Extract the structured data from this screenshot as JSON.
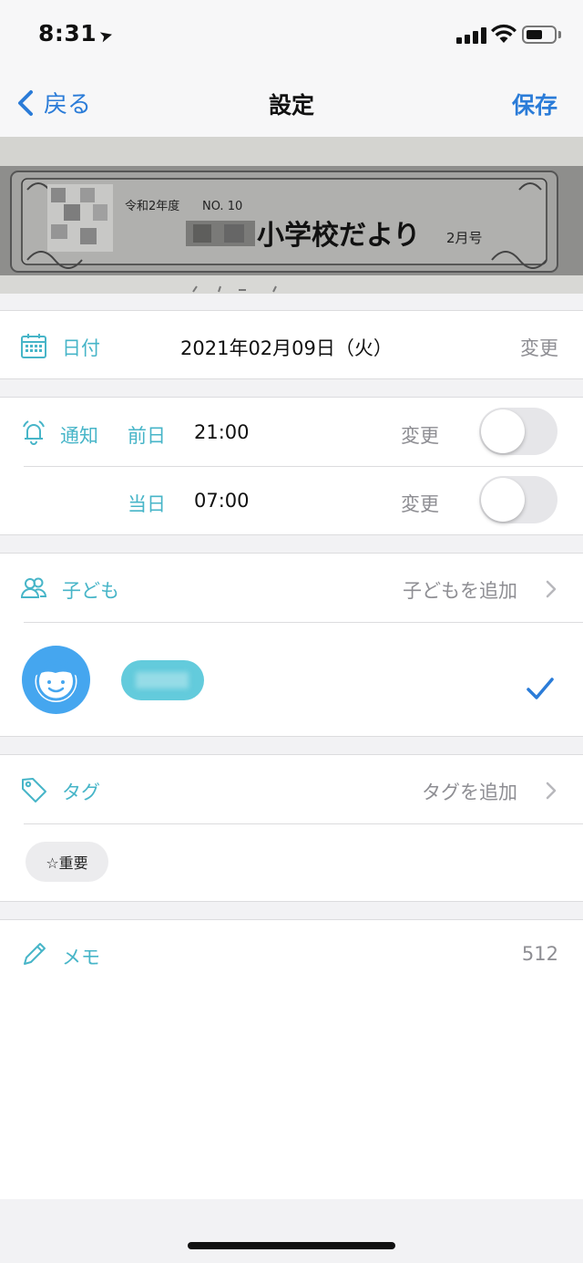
{
  "status_bar": {
    "time": "8:31"
  },
  "nav": {
    "back_label": "戻る",
    "title": "設定",
    "save_label": "保存"
  },
  "photo": {
    "era_text": "令和2年度",
    "issue_no": "NO. 10",
    "headline": "小学校だより",
    "month": "2月号"
  },
  "date_section": {
    "label": "日付",
    "value": "2021年02月09日（火）",
    "change_label": "変更"
  },
  "notify_section": {
    "label": "通知",
    "rows": [
      {
        "day_label": "前日",
        "time": "21:00",
        "change_label": "変更",
        "enabled": false
      },
      {
        "day_label": "当日",
        "time": "07:00",
        "change_label": "変更",
        "enabled": false
      }
    ]
  },
  "children_section": {
    "label": "子ども",
    "add_label": "子どもを追加"
  },
  "tag_section": {
    "label": "タグ",
    "add_label": "タグを追加",
    "tags": [
      "☆重要"
    ]
  },
  "memo_section": {
    "label": "メモ",
    "remaining": "512"
  },
  "colors": {
    "accent": "#2b7cd8",
    "teal": "#47b5c8",
    "avatar": "#45a6ef",
    "child_pill": "#63cbdc"
  },
  "icons": [
    "location-arrow-icon",
    "signal-icon",
    "wifi-icon",
    "battery-icon",
    "back-chevron-icon",
    "calendar-icon",
    "alarm-bell-icon",
    "children-icon",
    "chevron-right-icon",
    "child-face-icon",
    "checkmark-icon",
    "tag-icon",
    "pencil-icon"
  ]
}
